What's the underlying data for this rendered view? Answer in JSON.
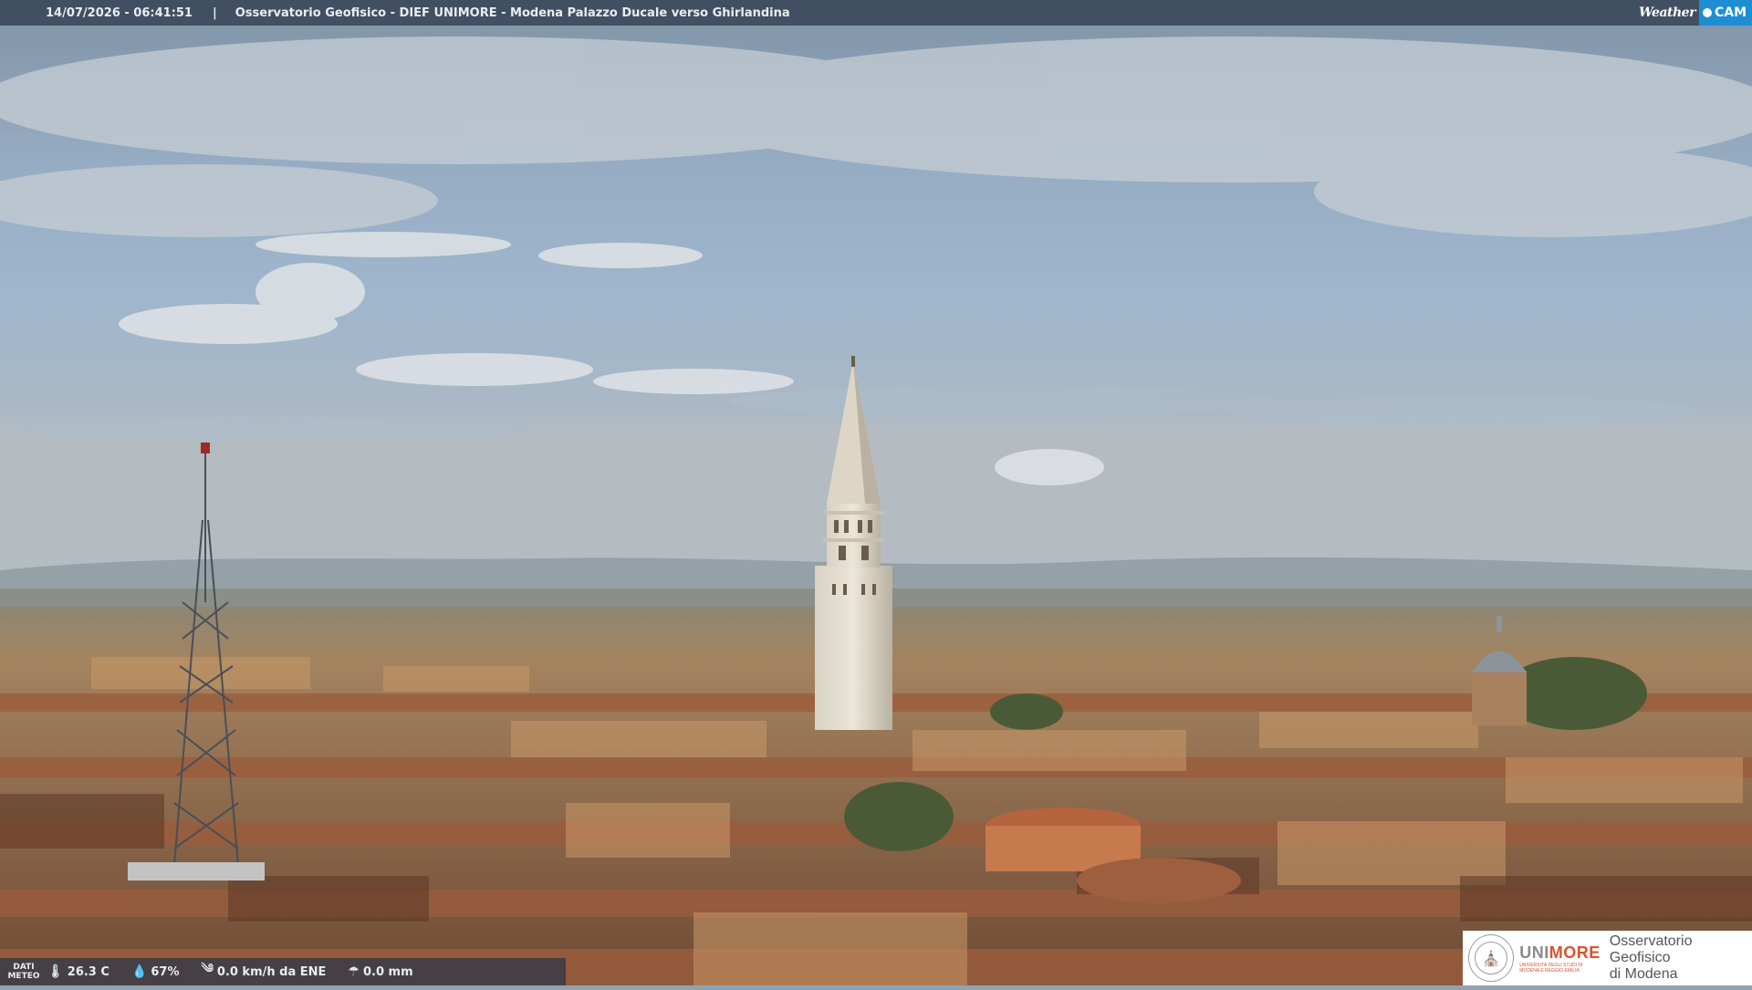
{
  "camera": {
    "timestamp": "14/07/2026 - 06:41:51",
    "separator": "|",
    "title": "Osservatorio Geofisico - DIEF UNIMORE - Modena Palazzo Ducale verso Ghirlandina"
  },
  "brand": {
    "weather": "Weather",
    "cam": "CAM"
  },
  "meteo": {
    "label_line1": "DATI",
    "label_line2": "METEO",
    "temperature": "26.3 C",
    "humidity": "67%",
    "wind": "0.0 km/h da ENE",
    "rain": "0.0 mm"
  },
  "logo": {
    "university": "UNI",
    "university_accent": "MORE",
    "university_sub1": "UNIVERSITÀ DEGLI STUDI DI",
    "university_sub2": "MODENA E REGGIO EMILIA",
    "observatory_line1": "Osservatorio Geofisico",
    "observatory_line2": "di Modena"
  },
  "colors": {
    "overlay": "#283446",
    "accent_blue": "#1d8ed4",
    "unimore_orange": "#d9532a"
  },
  "icons": [
    "thermometer-icon",
    "humidity-drop-icon",
    "wind-icon",
    "rain-icon"
  ]
}
